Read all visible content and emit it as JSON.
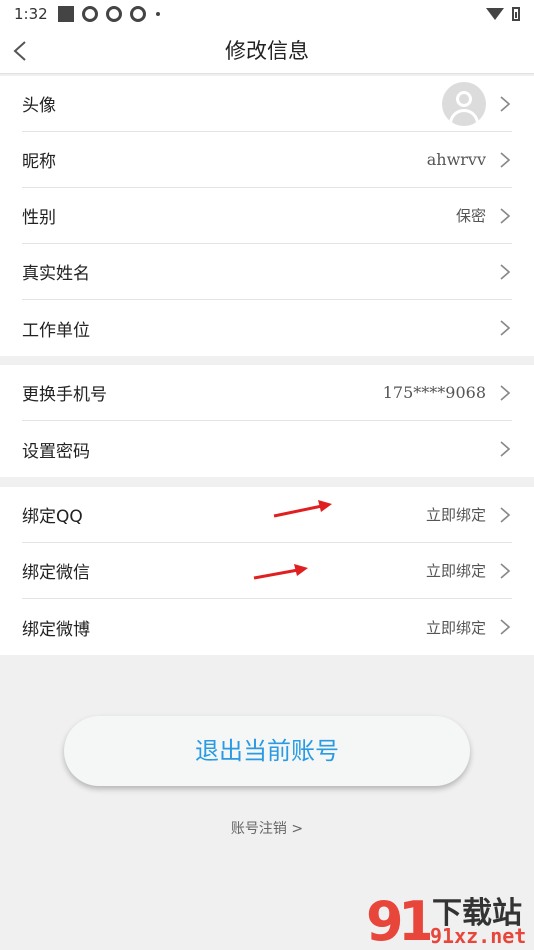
{
  "status_bar": {
    "time": "1:32"
  },
  "nav": {
    "title": "修改信息"
  },
  "profile_rows": [
    {
      "label": "头像",
      "value": ""
    },
    {
      "label": "昵称",
      "value": "ahwrvv"
    },
    {
      "label": "性别",
      "value": "保密"
    },
    {
      "label": "真实姓名",
      "value": ""
    },
    {
      "label": "工作单位",
      "value": ""
    }
  ],
  "account_rows": [
    {
      "label": "更换手机号",
      "value": "175****9068"
    },
    {
      "label": "设置密码",
      "value": ""
    }
  ],
  "binding_rows": [
    {
      "label": "绑定QQ",
      "value": "立即绑定"
    },
    {
      "label": "绑定微信",
      "value": "立即绑定"
    },
    {
      "label": "绑定微博",
      "value": "立即绑定"
    }
  ],
  "actions": {
    "logout_label": "退出当前账号",
    "cancel_account_label": "账号注销 >"
  },
  "watermark": {
    "top": "下载站",
    "bottom": "91xz.net"
  },
  "colors": {
    "accent": "#2a9be2",
    "annotation_arrow": "#e02020"
  }
}
